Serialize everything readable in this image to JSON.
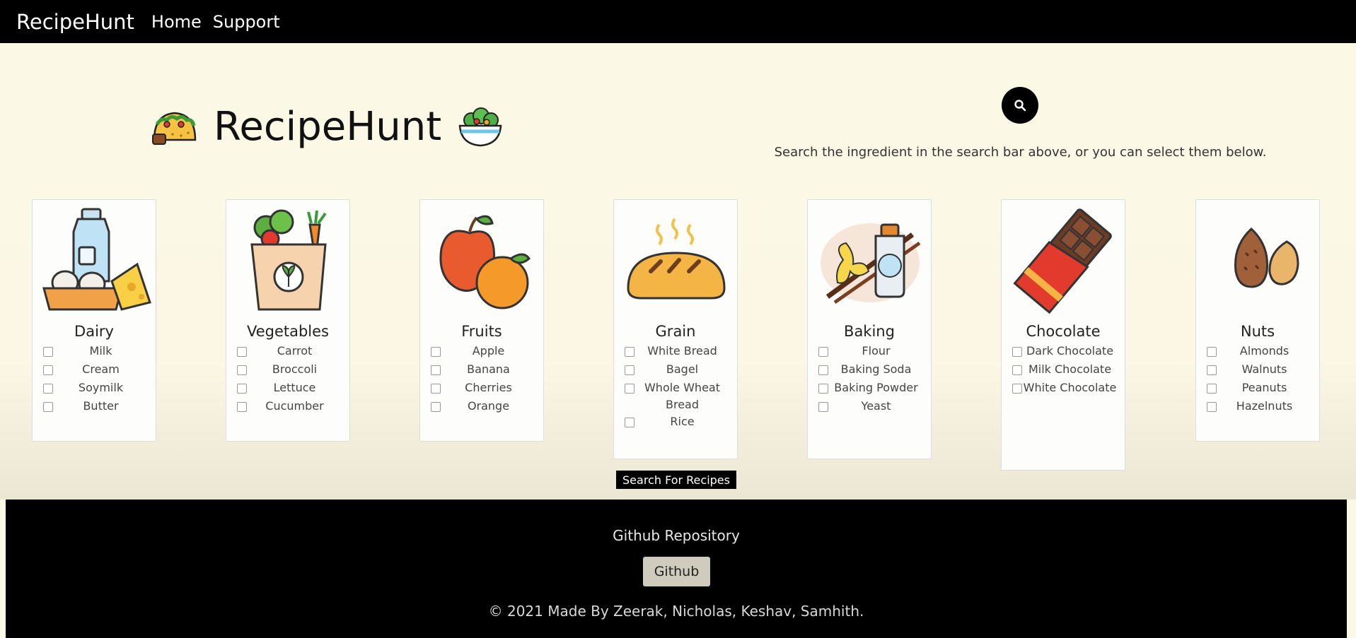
{
  "nav": {
    "brand": "RecipeHunt",
    "links": [
      "Home",
      "Support"
    ]
  },
  "hero": {
    "title": "RecipeHunt",
    "left_icon": "taco-icon",
    "right_icon": "salad-bowl-icon"
  },
  "search": {
    "icon": "search-icon",
    "hint": "Search the ingredient in the search bar above, or you can select them below."
  },
  "categories": [
    {
      "title": "Dairy",
      "icon": "dairy-icon",
      "items": [
        "Milk",
        "Cream",
        "Soymilk",
        "Butter"
      ]
    },
    {
      "title": "Vegetables",
      "icon": "vegetables-bag-icon",
      "items": [
        "Carrot",
        "Broccoli",
        "Lettuce",
        "Cucumber"
      ]
    },
    {
      "title": "Fruits",
      "icon": "fruits-icon",
      "items": [
        "Apple",
        "Banana",
        "Cherries",
        "Orange"
      ]
    },
    {
      "title": "Grain",
      "icon": "bread-icon",
      "items": [
        "White Bread",
        "Bagel",
        "Whole Wheat Bread",
        "Rice"
      ]
    },
    {
      "title": "Baking",
      "icon": "vanilla-extract-icon",
      "items": [
        "Flour",
        "Baking Soda",
        "Baking Powder",
        "Yeast"
      ]
    },
    {
      "title": "Chocolate",
      "icon": "chocolate-bar-icon",
      "items": [
        "Dark Chocolate",
        "Milk Chocolate",
        "White Chocolate"
      ]
    },
    {
      "title": "Nuts",
      "icon": "almonds-icon",
      "items": [
        "Almonds",
        "Walnuts",
        "Peanuts",
        "Hazelnuts"
      ]
    }
  ],
  "submit_label": "Search For Recipes",
  "footer": {
    "title": "Github Repository",
    "button": "Github",
    "copyright": "© 2021 Made By Zeerak, Nicholas, Keshav, Samhith."
  }
}
